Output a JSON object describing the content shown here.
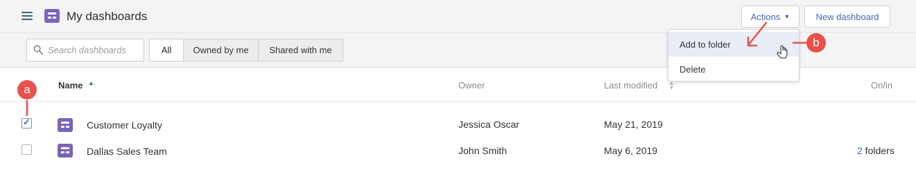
{
  "header": {
    "title": "My dashboards",
    "actions_label": "Actions",
    "new_dashboard_label": "New dashboard"
  },
  "toolbar": {
    "search_placeholder": "Search dashboards",
    "filters": [
      "All",
      "Owned by me",
      "Shared with me"
    ],
    "active_filter": "All"
  },
  "table": {
    "columns": [
      "Name",
      "Owner",
      "Last modified",
      "On/in"
    ],
    "rows": [
      {
        "name": "Customer Loyalty",
        "owner": "Jessica Oscar",
        "modified": "May 21, 2019",
        "onin_count": "",
        "onin_label": "",
        "checked": true
      },
      {
        "name": "Dallas Sales Team",
        "owner": "John Smith",
        "modified": "May 6, 2019",
        "onin_count": "2",
        "onin_label": " folders",
        "checked": false
      }
    ]
  },
  "actions_menu": {
    "items": [
      "Add to folder",
      "Delete"
    ],
    "hovered": "Add to folder"
  },
  "callouts": {
    "a": "a",
    "b": "b"
  },
  "colors": {
    "accent": "#3d6ab3",
    "dashboard_icon": "#7a64b8",
    "callout": "#e8504a",
    "header_bg": "#f4f4f4"
  },
  "icons": [
    "menu-icon",
    "dashboard-icon",
    "search-icon",
    "sort-asc-icon",
    "sort-icon",
    "check-icon",
    "caret-down-icon",
    "pointer-hand-icon",
    "arrow-icon"
  ]
}
